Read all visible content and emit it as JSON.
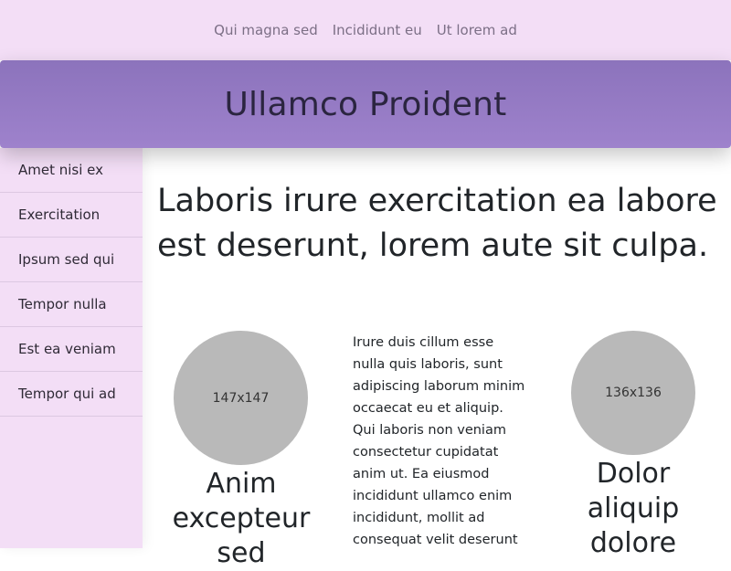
{
  "topnav": {
    "links": [
      "Qui magna sed",
      "Incididunt eu",
      "Ut lorem ad"
    ]
  },
  "hero": {
    "title": "Ullamco Proident"
  },
  "sidebar": {
    "items": [
      "Amet nisi ex",
      "Exercitation",
      "Ipsum sed qui",
      "Tempor nulla",
      "Est ea veniam",
      "Tempor qui ad"
    ]
  },
  "main": {
    "heading": "Laboris irure exercitation ea labore est deserunt, lorem aute sit culpa.",
    "columns": [
      {
        "placeholder": "147x147",
        "caption": "Anim excepteur sed"
      },
      {
        "text": "Irure duis cillum esse nulla quis laboris, sunt adipiscing laborum minim occaecat eu et aliquip. Qui laboris non veniam consectetur cupidatat anim ut. Ea eiusmod incididunt ullamco enim incididunt, mollit ad consequat velit deserunt"
      },
      {
        "placeholder": "136x136",
        "caption": "Dolor aliquip dolore"
      }
    ]
  },
  "colors": {
    "nav_bg": "#f3def6",
    "hero_bg": "#9e82cc",
    "placeholder_bg": "#b9b9b9"
  }
}
